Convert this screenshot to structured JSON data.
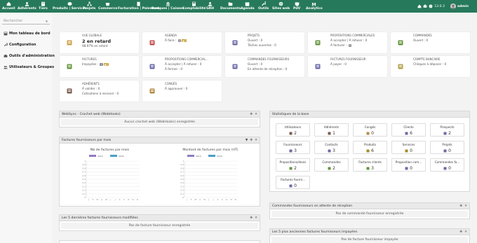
{
  "topmenu": {
    "items": [
      {
        "label": "Accueil",
        "icon": "home-icon"
      },
      {
        "label": "Adhérents",
        "icon": "members-icon"
      },
      {
        "label": "Tiers",
        "icon": "thirdparty-icon"
      },
      {
        "label": "Produits | Services",
        "icon": "product-icon"
      },
      {
        "label": "Projets",
        "icon": "project-icon"
      },
      {
        "label": "Commerce",
        "icon": "commerce-icon"
      },
      {
        "label": "Facturation | Paiement",
        "icon": "billing-icon"
      },
      {
        "label": "Banques | Caisses",
        "icon": "bank-icon"
      },
      {
        "label": "Comptabilité",
        "icon": "accounting-icon"
      },
      {
        "label": "GRH",
        "icon": "hrm-icon"
      },
      {
        "label": "Documents",
        "icon": "documents-icon"
      },
      {
        "label": "Agenda",
        "icon": "agenda-icon"
      },
      {
        "label": "Outils",
        "icon": "tools-icon"
      },
      {
        "label": "Sites web",
        "icon": "website-icon"
      },
      {
        "label": "PdV",
        "icon": "pos-icon"
      },
      {
        "label": "Analytics",
        "icon": "analytics-icon"
      }
    ],
    "version": "13.0.3",
    "user": "admin"
  },
  "sidebar": {
    "search_placeholder": "Rechercher",
    "items": [
      {
        "label": "Mon tableau de bord"
      },
      {
        "label": "Configuration"
      },
      {
        "label": "Outils d'administration"
      },
      {
        "label": "Utilisateurs & Groupes"
      }
    ]
  },
  "boxes": [
    {
      "title": "Vue globale",
      "big": "2 en retard",
      "lines": [
        "98.97% en retard"
      ],
      "color": "#cf9f48"
    },
    {
      "title": "Agenda",
      "lines": [
        "À faire : "
      ],
      "badges": [
        "2",
        "1"
      ],
      "color": "#c74c4c"
    },
    {
      "title": "Projets",
      "lines": [
        "Ouvert : 0",
        "Tâches ouvertes : 0"
      ],
      "color": "#6c6aa8"
    },
    {
      "title": "Propositions commerciales",
      "lines": [
        "À accepter | À refuser : 0",
        "À facturer : "
      ],
      "badges2": [
        "0"
      ],
      "color": "#65953d"
    },
    {
      "title": "Commandes",
      "lines": [
        "Ouvert : 0"
      ],
      "color": "#65953d"
    },
    {
      "title": "Factures",
      "lines": [
        "Impayées : "
      ],
      "badges": [
        "2",
        "2"
      ],
      "color": "#65953d"
    },
    {
      "title": "Propositions commercial...",
      "lines": [
        "À accepter | À refuser : 0",
        "À fermer : 0"
      ],
      "color": "#6c6aa8"
    },
    {
      "title": "Commandes fournisseurs",
      "lines": [
        "Ouvert : 0",
        "En attente de réception : 0"
      ],
      "color": "#6c6aa8"
    },
    {
      "title": "Factures fournisseur",
      "lines": [
        "À payer : 0"
      ],
      "color": "#6c6aa8"
    },
    {
      "title": "Compte bancaire",
      "lines": [
        "Chèques à déposer : 0"
      ],
      "color": "#b0a04a"
    },
    {
      "title": "Adhérents",
      "lines": [
        "À valider : 0",
        "Cotisations à recevoir : 0"
      ],
      "color": "#7a5b4b"
    },
    {
      "title": "Congés",
      "lines": [
        "À approuver : 0"
      ],
      "color": "#b38b45"
    }
  ],
  "panels": {
    "webhooks": {
      "title": "WebSync - Crochet web (WebHooks)",
      "note": "Aucun crochet web (WebHooks) enregistrée"
    },
    "supplier_invoices": {
      "title": "Factures fournisseurs par mois",
      "chart1_title": "Nb de factures par mois",
      "chart2_title": "Montant de factures par mois (HT)",
      "legend": [
        "2019",
        "2020"
      ]
    },
    "last_supplier": {
      "title": "Les 5 dernières factures fournisseurs modifiées",
      "note": "Pas de facture fournisseur enregistrée"
    },
    "stats": {
      "title": "Statistiques de la base"
    },
    "orders_waiting": {
      "title": "Commandes fournisseurs en attente de réception",
      "note": "Pas de commande fournisseur enregistrée"
    },
    "oldest_unpaid": {
      "title": "Les 5 plus anciennes factures fournisseurs impayées",
      "note": "Pas de facture fournisseur impayée"
    }
  },
  "stats": [
    {
      "label": "Utilisateurs",
      "value": "2",
      "icon": "users-icon",
      "color": "#7a5b4b"
    },
    {
      "label": "Adhérents",
      "value": "1",
      "icon": "members-icon",
      "color": "#7a5b4b"
    },
    {
      "label": "Congés",
      "value": "0",
      "icon": "leave-icon",
      "color": "#b38b45"
    },
    {
      "label": "Clients",
      "value": "6",
      "icon": "customer-icon",
      "color": "#6c6aa8"
    },
    {
      "label": "Prospects",
      "value": "2",
      "icon": "prospect-icon",
      "color": "#6c6aa8"
    },
    {
      "label": "Fournisseurs",
      "value": "3",
      "icon": "supplier-icon",
      "color": "#6c6aa8"
    },
    {
      "label": "Contacts",
      "value": "3",
      "icon": "contact-icon",
      "color": "#6c6aa8"
    },
    {
      "label": "Produits",
      "value": "6",
      "icon": "product-icon",
      "color": "#a38b1f"
    },
    {
      "label": "Services",
      "value": "0",
      "icon": "service-icon",
      "color": "#a38b1f"
    },
    {
      "label": "Projets",
      "value": "0",
      "icon": "project-icon",
      "color": "#6c6aa8"
    },
    {
      "label": "Propositions/devis",
      "value": "2",
      "icon": "proposal-icon",
      "color": "#65953d"
    },
    {
      "label": "Commandes",
      "value": "2",
      "icon": "order-icon",
      "color": "#65953d"
    },
    {
      "label": "Factures clients",
      "value": "3",
      "icon": "invoice-icon",
      "color": "#65953d"
    },
    {
      "label": "Proposition com...",
      "value": "0",
      "icon": "supplier-proposal-icon",
      "color": "#6c6aa8"
    },
    {
      "label": "Commandes fo...",
      "value": "0",
      "icon": "supplier-order-icon",
      "color": "#6c6aa8"
    },
    {
      "label": "Factures fourni...",
      "value": "0",
      "icon": "supplier-invoice-icon",
      "color": "#6c6aa8"
    }
  ],
  "chart_data": [
    {
      "type": "bar",
      "title": "Nb de factures par mois",
      "categories": [
        "J",
        "F",
        "M",
        "A",
        "M",
        "J",
        "J",
        "A",
        "S",
        "O",
        "N",
        "D"
      ],
      "series": [
        {
          "name": "2019",
          "values": [
            0,
            0,
            0,
            0,
            0,
            0,
            0,
            0,
            0,
            0,
            0,
            0
          ]
        },
        {
          "name": "2020",
          "values": [
            0,
            0,
            0,
            0,
            0,
            0,
            0,
            0,
            0,
            0,
            0,
            0
          ]
        }
      ],
      "ylim": [
        0,
        1
      ],
      "yticks": [
        "1",
        "0.9",
        "0.8",
        "0.7",
        "0.6",
        "0.5",
        "0.4",
        "0.3",
        "0.2",
        "0.1",
        "0"
      ],
      "colors": [
        "#8e7cc3",
        "#4a9fc6"
      ]
    },
    {
      "type": "bar",
      "title": "Montant de factures par mois (HT)",
      "categories": [
        "J",
        "F",
        "M",
        "A",
        "M",
        "J",
        "J",
        "A",
        "S",
        "O",
        "N",
        "D"
      ],
      "series": [
        {
          "name": "2019",
          "values": [
            0,
            0,
            0,
            0,
            0,
            0,
            0,
            0,
            0,
            0,
            0,
            0
          ]
        },
        {
          "name": "2020",
          "values": [
            0,
            0,
            0,
            0,
            0,
            0,
            0,
            0,
            0,
            0,
            0,
            0
          ]
        }
      ],
      "ylim": [
        0,
        1
      ],
      "yticks": [
        "1",
        "0.9",
        "0.8",
        "0.7",
        "0.6",
        "0.5",
        "0.4",
        "0.3",
        "0.2",
        "0.1",
        "0"
      ],
      "colors": [
        "#8e7cc3",
        "#4a9fc6"
      ]
    }
  ]
}
